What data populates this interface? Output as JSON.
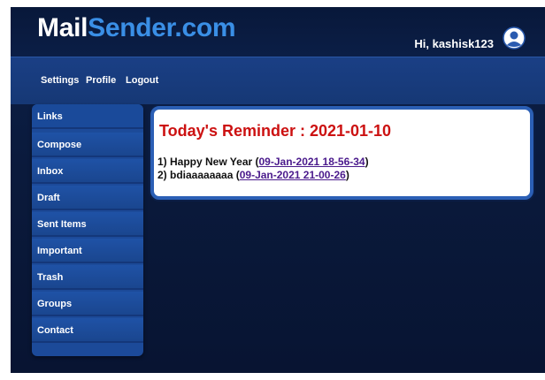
{
  "header": {
    "logo_part1": "Mail",
    "logo_part2": "Sender.com",
    "greeting": "Hi, kashisk123",
    "user_icon": "user-avatar-icon"
  },
  "topnav": {
    "items": [
      {
        "label": "Settings"
      },
      {
        "label": "Profile"
      },
      {
        "label": "Logout"
      }
    ]
  },
  "sidebar": {
    "items": [
      {
        "label": "Links"
      },
      {
        "label": "Compose"
      },
      {
        "label": "Inbox"
      },
      {
        "label": "Draft"
      },
      {
        "label": "Sent Items"
      },
      {
        "label": "Important"
      },
      {
        "label": "Trash"
      },
      {
        "label": "Groups"
      },
      {
        "label": "Contact"
      }
    ]
  },
  "reminder": {
    "title": "Today's Reminder : 2021-01-10",
    "items": [
      {
        "prefix": "1) Happy New Year ",
        "link": "09-Jan-2021 18-56-34"
      },
      {
        "prefix": "2) bdiaaaaaaaa ",
        "link": "09-Jan-2021 21-00-26"
      }
    ]
  },
  "colors": {
    "background": "#0a1a3c",
    "nav": "#1a3f85",
    "logo_accent": "#3a8fe6",
    "title_red": "#cc1111",
    "link": "#4a1a8c"
  }
}
